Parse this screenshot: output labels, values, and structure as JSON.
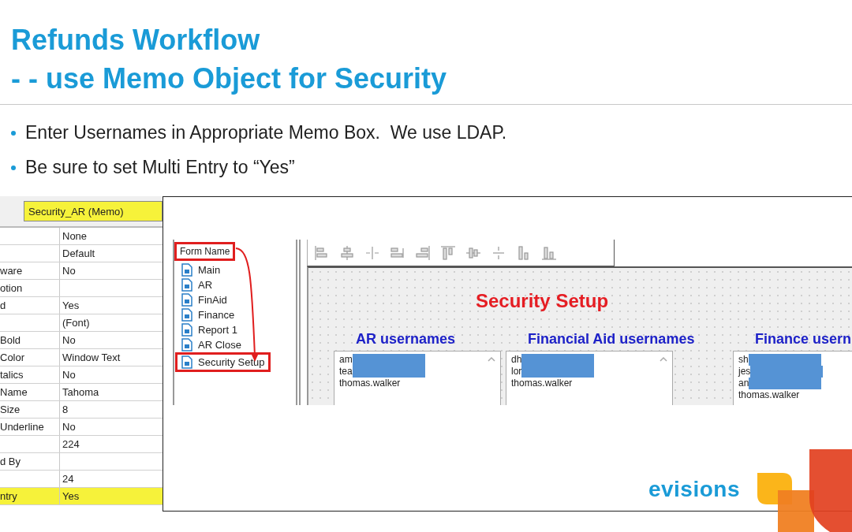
{
  "title_lines": [
    "Refunds Workflow",
    "- - use Memo Object for Security"
  ],
  "bullets": [
    "Enter Usernames in Appropriate Memo Box.  We use LDAP.",
    "Be sure to set Multi Entry to “Yes”"
  ],
  "property_grid": {
    "object": "Security_AR (Memo)",
    "object_highlighted": true,
    "rows": [
      {
        "name": "",
        "value": "None",
        "highlighted": false
      },
      {
        "name": "",
        "value": "Default",
        "highlighted": false
      },
      {
        "name": "ware",
        "value": "No",
        "highlighted": false
      },
      {
        "name": "otion",
        "value": "",
        "highlighted": false
      },
      {
        "name": "d",
        "value": "Yes",
        "highlighted": false
      },
      {
        "name": "",
        "value": "(Font)",
        "highlighted": false
      },
      {
        "name": "Bold",
        "value": "No",
        "highlighted": false
      },
      {
        "name": "Color",
        "value": "Window Text",
        "highlighted": false
      },
      {
        "name": "talics",
        "value": "No",
        "highlighted": false
      },
      {
        "name": "Name",
        "value": "Tahoma",
        "highlighted": false
      },
      {
        "name": "Size",
        "value": "8",
        "highlighted": false
      },
      {
        "name": "Underline",
        "value": "No",
        "highlighted": false
      },
      {
        "name": "",
        "value": "224",
        "highlighted": false
      },
      {
        "name": "d By",
        "value": "",
        "highlighted": false
      },
      {
        "name": "",
        "value": "24",
        "highlighted": false
      },
      {
        "name": "ntry",
        "value": "Yes",
        "highlighted": true
      }
    ]
  },
  "form_tree": {
    "header": "Form Name",
    "header_marked": true,
    "items": [
      {
        "label": "Main",
        "marked": false
      },
      {
        "label": "AR",
        "marked": false
      },
      {
        "label": "FinAid",
        "marked": false
      },
      {
        "label": "Finance",
        "marked": false
      },
      {
        "label": "Report 1",
        "marked": false
      },
      {
        "label": "AR Close",
        "marked": false
      },
      {
        "label": "Security Setup",
        "marked": true
      }
    ]
  },
  "form": {
    "title": "Security Setup",
    "memos": [
      {
        "heading": "AR usernames",
        "lines": [
          {
            "text": "am",
            "redacted": true
          },
          {
            "text": "tea",
            "redacted": true
          },
          {
            "text": "thomas.walker",
            "redacted": false
          }
        ]
      },
      {
        "heading": "Financial Aid usernames",
        "lines": [
          {
            "text": "dh",
            "redacted": true
          },
          {
            "text": "lor",
            "redacted": true
          },
          {
            "text": "thomas.walker",
            "redacted": false
          }
        ]
      },
      {
        "heading": "Finance usern",
        "lines": [
          {
            "text": "sh",
            "redacted": true
          },
          {
            "text": "jes",
            "redacted": true
          },
          {
            "text": "an",
            "redacted": true
          },
          {
            "text": "thomas.walker",
            "redacted": false
          }
        ]
      }
    ]
  },
  "logo": {
    "text": "evisions"
  }
}
